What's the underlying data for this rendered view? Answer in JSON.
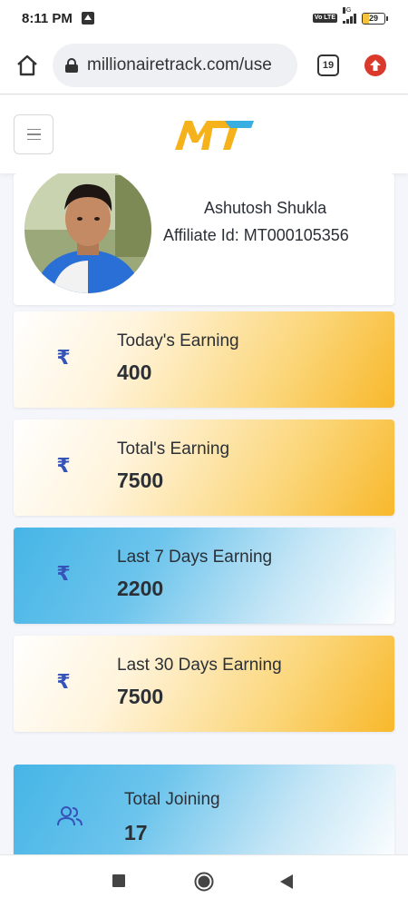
{
  "status_bar": {
    "time": "8:11 PM",
    "network_type": "4G",
    "volte": "Vo LTE",
    "battery_level": "29",
    "battery_fraction": 0.29,
    "icons": [
      "upload-icon",
      "volte-icon",
      "signal-icon",
      "battery-icon"
    ]
  },
  "browser": {
    "url": "millionairetrack.com/use",
    "tab_count": "19",
    "icons": [
      "home-icon",
      "lock-icon",
      "tabs-icon",
      "update-arrow-icon"
    ]
  },
  "header": {
    "logo_text": "MT",
    "colors": {
      "logo_primary": "#f6b21b",
      "logo_accent": "#39aee0"
    },
    "icons": [
      "hamburger-menu-icon"
    ]
  },
  "profile": {
    "name": "Ashutosh Shukla",
    "affiliate": "Affiliate Id: MT000105356"
  },
  "stats": [
    {
      "label": "Today's Earning",
      "value": "400",
      "icon": "rupee-icon",
      "symbol": "₹",
      "theme": "gold"
    },
    {
      "label": "Total's Earning",
      "value": "7500",
      "icon": "rupee-icon",
      "symbol": "₹",
      "theme": "gold"
    },
    {
      "label": "Last 7 Days Earning",
      "value": "2200",
      "icon": "rupee-icon",
      "symbol": "₹",
      "theme": "blue"
    },
    {
      "label": "Last 30 Days Earning",
      "value": "7500",
      "icon": "rupee-icon",
      "symbol": "₹",
      "theme": "gold"
    },
    {
      "label": "Total Joining",
      "value": "17",
      "icon": "users-icon",
      "symbol": "",
      "theme": "blue"
    }
  ],
  "system_nav": {
    "icons": [
      "recents-square-icon",
      "home-circle-icon",
      "back-triangle-icon"
    ]
  },
  "colors": {
    "icon_blue": "#3553b8",
    "gold_gradient_end": "#f8b82b",
    "blue_gradient_start": "#45b5e6",
    "page_bg": "#f4f6fb"
  }
}
